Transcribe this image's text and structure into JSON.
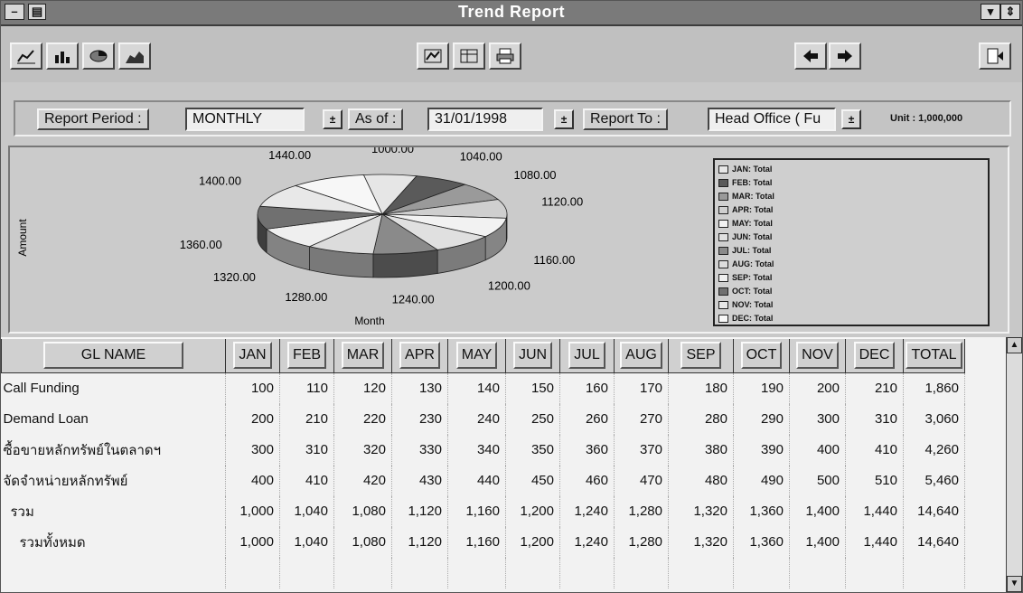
{
  "window": {
    "title": "Trend Report"
  },
  "toolbar": {
    "left_buttons": [
      "line-chart-icon",
      "bar-chart-icon",
      "pie-chart-icon",
      "area-chart-icon"
    ],
    "middle_buttons": [
      "chart-settings-icon",
      "data-view-icon",
      "print-icon"
    ],
    "nav_buttons": [
      "prev-arrow-icon",
      "next-arrow-icon"
    ],
    "exit_button": "exit-door-icon"
  },
  "params": {
    "period_label": "Report Period :",
    "period_value": "MONTHLY",
    "asof_label": "As of :",
    "asof_value": "31/01/1998",
    "report_to_label": "Report To :",
    "report_to_value": "Head Office ( Fu",
    "unit": "Unit : 1,000,000"
  },
  "chart_data": {
    "type": "pie",
    "ylabel": "Amount",
    "xlabel": "Month",
    "categories": [
      "JAN",
      "FEB",
      "MAR",
      "APR",
      "MAY",
      "JUN",
      "JUL",
      "AUG",
      "SEP",
      "OCT",
      "NOV",
      "DEC"
    ],
    "values": [
      1000,
      1040,
      1080,
      1120,
      1160,
      1200,
      1240,
      1280,
      1320,
      1360,
      1400,
      1440
    ],
    "slice_labels": [
      "1000.00",
      "1040.00",
      "1080.00",
      "1120.00",
      "1160.00",
      "1200.00",
      "1240.00",
      "1280.00",
      "1320.00",
      "1360.00",
      "1400.00",
      "1440.00"
    ],
    "legend": [
      "JAN: Total",
      "FEB: Total",
      "MAR: Total",
      "APR: Total",
      "MAY: Total",
      "JUN: Total",
      "JUL: Total",
      "AUG: Total",
      "SEP: Total",
      "OCT: Total",
      "NOV: Total",
      "DEC: Total"
    ],
    "legend_position": "right",
    "colors": [
      "#e6e6e6",
      "#5a5a5a",
      "#9a9a9a",
      "#cfcfcf",
      "#f2f2f2",
      "#e0e0e0",
      "#8a8a8a",
      "#dcdcdc",
      "#efefef",
      "#707070",
      "#e8e8e8",
      "#f7f7f7"
    ]
  },
  "table": {
    "columns": [
      "GL NAME",
      "JAN",
      "FEB",
      "MAR",
      "APR",
      "MAY",
      "JUN",
      "JUL",
      "AUG",
      "SEP",
      "OCT",
      "NOV",
      "DEC",
      "TOTAL"
    ],
    "rows": [
      {
        "name": "Call Funding",
        "values": [
          "100",
          "110",
          "120",
          "130",
          "140",
          "150",
          "160",
          "170",
          "180",
          "190",
          "200",
          "210",
          "1,860"
        ]
      },
      {
        "name": "Demand Loan",
        "values": [
          "200",
          "210",
          "220",
          "230",
          "240",
          "250",
          "260",
          "270",
          "280",
          "290",
          "300",
          "310",
          "3,060"
        ]
      },
      {
        "name": "ซื้อขายหลักทรัพย์ในตลาดฯ",
        "values": [
          "300",
          "310",
          "320",
          "330",
          "340",
          "350",
          "360",
          "370",
          "380",
          "390",
          "400",
          "410",
          "4,260"
        ]
      },
      {
        "name": "จัดจำหน่ายหลักทรัพย์",
        "values": [
          "400",
          "410",
          "420",
          "430",
          "440",
          "450",
          "460",
          "470",
          "480",
          "490",
          "500",
          "510",
          "5,460"
        ]
      },
      {
        "name": "รวม",
        "indent": 1,
        "values": [
          "1,000",
          "1,040",
          "1,080",
          "1,120",
          "1,160",
          "1,200",
          "1,240",
          "1,280",
          "1,320",
          "1,360",
          "1,400",
          "1,440",
          "14,640"
        ]
      },
      {
        "name": "รวมทั้งหมด",
        "indent": 2,
        "values": [
          "1,000",
          "1,040",
          "1,080",
          "1,120",
          "1,160",
          "1,200",
          "1,240",
          "1,280",
          "1,320",
          "1,360",
          "1,400",
          "1,440",
          "14,640"
        ]
      }
    ]
  }
}
